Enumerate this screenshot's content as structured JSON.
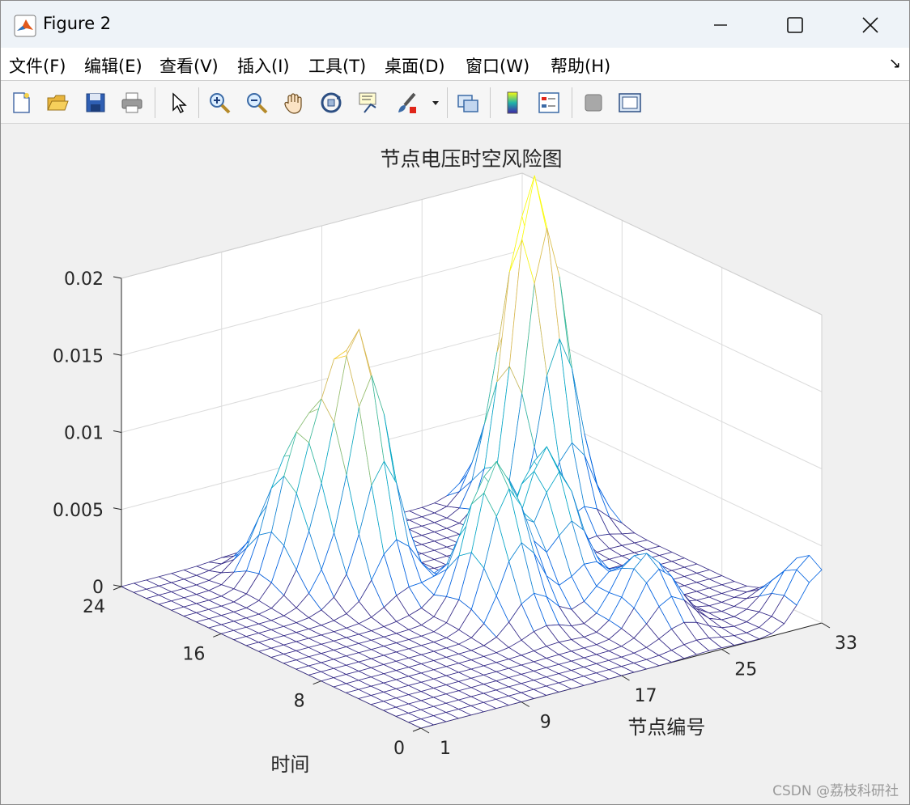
{
  "window": {
    "title": "Figure 2",
    "icon": "matlab-icon",
    "controls": [
      "minimize-icon",
      "maximize-icon",
      "close-icon"
    ]
  },
  "menu": {
    "items": [
      "文件(F)",
      "编辑(E)",
      "查看(V)",
      "插入(I)",
      "工具(T)",
      "桌面(D)",
      "窗口(W)",
      "帮助(H)"
    ],
    "overflow": "↘"
  },
  "toolbar": {
    "tools": [
      "new-figure-icon",
      "open-file-icon",
      "save-icon",
      "print-icon",
      "pointer-icon",
      "zoom-in-icon",
      "zoom-out-icon",
      "pan-icon",
      "rotate-3d-icon",
      "data-cursor-icon",
      "brush-icon",
      "link-plot-icon",
      "colorbar-icon",
      "legend-icon",
      "hide-plot-tools-icon",
      "show-plot-tools-icon"
    ]
  },
  "chart_data": {
    "type": "surface-mesh-3d",
    "title": "节点电压时空风险图",
    "xlabel": "节点编号",
    "ylabel": "时间",
    "zlabel": "",
    "x_ticks": [
      "1",
      "9",
      "17",
      "25",
      "33"
    ],
    "y_ticks": [
      "0",
      "8",
      "16",
      "24"
    ],
    "z_ticks": [
      "0",
      "0.005",
      "0.01",
      "0.015",
      "0.02"
    ],
    "xlim": [
      1,
      33
    ],
    "ylim": [
      0,
      24
    ],
    "zlim": [
      0,
      0.02
    ],
    "grid": true,
    "colormap": "parula",
    "peaks": [
      {
        "node": 13,
        "time": 17,
        "value": 0.016
      },
      {
        "node": 30,
        "time": 20,
        "value": 0.022
      },
      {
        "node": 17,
        "time": 10,
        "value": 0.01
      },
      {
        "node": 22,
        "time": 11,
        "value": 0.0095
      },
      {
        "node": 10,
        "time": 19,
        "value": 0.0085
      },
      {
        "node": 24,
        "time": 5,
        "value": 0.0045
      },
      {
        "node": 33,
        "time": 1,
        "value": 0.004
      }
    ]
  },
  "watermark": "CSDN @荔枝科研社"
}
